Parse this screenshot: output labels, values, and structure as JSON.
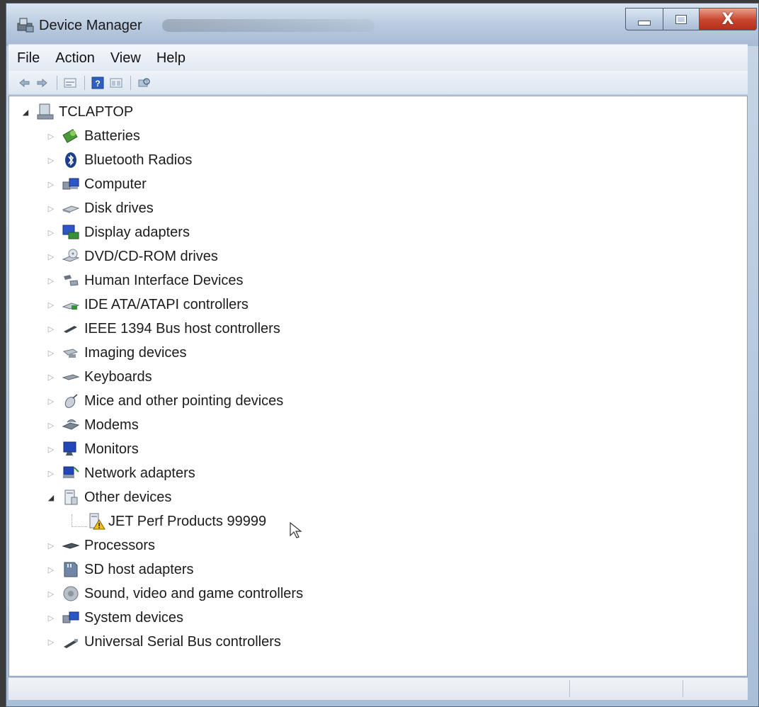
{
  "window": {
    "title": "Device Manager",
    "buttons": {
      "minimize": "minimize-icon",
      "maximize": "maximize-icon",
      "close": "X"
    }
  },
  "menubar": {
    "items": [
      "File",
      "Action",
      "View",
      "Help"
    ]
  },
  "toolbar": {
    "buttons": [
      "back-icon",
      "forward-icon",
      "properties-icon",
      "help-icon",
      "view-icon",
      "scan-hardware-icon"
    ]
  },
  "tree": {
    "root": "TCLAPTOP",
    "categories": [
      {
        "label": "Batteries",
        "icon": "battery-icon"
      },
      {
        "label": "Bluetooth Radios",
        "icon": "bluetooth-icon"
      },
      {
        "label": "Computer",
        "icon": "computer-icon"
      },
      {
        "label": "Disk drives",
        "icon": "disk-drive-icon"
      },
      {
        "label": "Display adapters",
        "icon": "display-adapter-icon"
      },
      {
        "label": "DVD/CD-ROM drives",
        "icon": "dvd-drive-icon"
      },
      {
        "label": "Human Interface Devices",
        "icon": "hid-icon"
      },
      {
        "label": "IDE ATA/ATAPI controllers",
        "icon": "ide-controller-icon"
      },
      {
        "label": "IEEE 1394 Bus host controllers",
        "icon": "ieee1394-icon"
      },
      {
        "label": "Imaging devices",
        "icon": "imaging-device-icon"
      },
      {
        "label": "Keyboards",
        "icon": "keyboard-icon"
      },
      {
        "label": "Mice and other pointing devices",
        "icon": "mouse-icon"
      },
      {
        "label": "Modems",
        "icon": "modem-icon"
      },
      {
        "label": "Monitors",
        "icon": "monitor-icon"
      },
      {
        "label": "Network adapters",
        "icon": "network-adapter-icon"
      },
      {
        "label": "Other devices",
        "icon": "other-devices-icon",
        "expanded": true,
        "children": [
          {
            "label": "JET Perf Products 99999",
            "icon": "unknown-device-warning-icon"
          }
        ]
      },
      {
        "label": "Processors",
        "icon": "processor-icon"
      },
      {
        "label": "SD host adapters",
        "icon": "sd-host-adapter-icon"
      },
      {
        "label": "Sound, video and game controllers",
        "icon": "sound-controller-icon"
      },
      {
        "label": "System devices",
        "icon": "system-devices-icon"
      },
      {
        "label": "Universal Serial Bus controllers",
        "icon": "usb-controller-icon"
      }
    ]
  },
  "colors": {
    "title_gradient_top": "#d9e4f0",
    "close_button": "#c8452d",
    "tree_background": "#ffffff",
    "warning": "#f2c200"
  }
}
